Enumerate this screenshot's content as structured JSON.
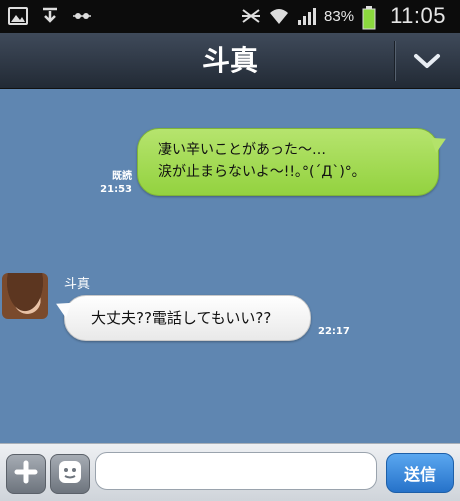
{
  "status_bar": {
    "icons": [
      "gallery-icon",
      "download-icon",
      "signal-dots-icon",
      "mute-icon",
      "wifi-icon",
      "cell-signal-icon",
      "battery-icon"
    ],
    "battery_text": "83%",
    "time": "11:05",
    "colors": {
      "background": "#0c0c0c",
      "battery": "#8bd93e"
    }
  },
  "header": {
    "title": "斗真",
    "menu_icon": "chevron-down-icon"
  },
  "chat": {
    "background_color": "#5f86b1",
    "messages": [
      {
        "direction": "outgoing",
        "text": "凄い辛いことがあった～…\n涙が止まらないよ～!!｡°(´Д`)°｡",
        "read_label": "既読",
        "time": "21:53",
        "bubble_color": "#a5db55"
      },
      {
        "direction": "incoming",
        "sender": "斗真",
        "text": "大丈夫??電話してもいい??",
        "time": "22:17",
        "bubble_color": "#ffffff"
      }
    ]
  },
  "input_bar": {
    "plus_icon": "plus-icon",
    "emoji_icon": "emoji-face-icon",
    "input_value": "",
    "input_placeholder": "",
    "send_label": "送信",
    "send_color": "#2e86de"
  }
}
